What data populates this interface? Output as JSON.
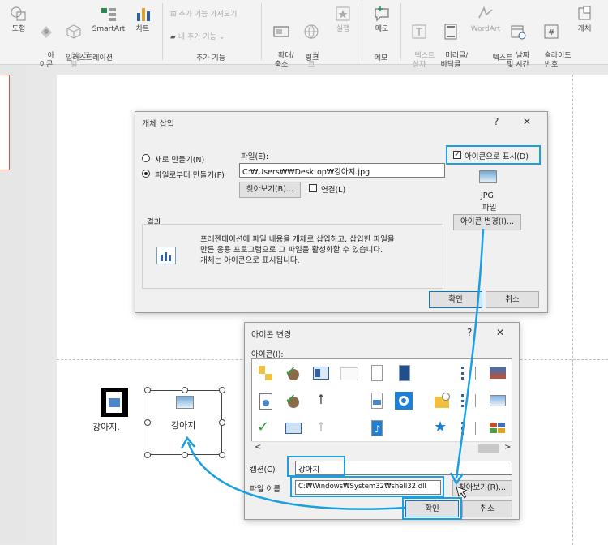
{
  "ribbon": {
    "groups": {
      "illustrations": {
        "label": "일러스트레이션",
        "items": [
          "도형",
          "아\n이콘",
          "3D 모\n델",
          "SmartArt",
          "차트"
        ]
      },
      "addins": {
        "label": "추가 기능",
        "get": "추가 기능 가져오기",
        "mine": "내 추가 기능"
      },
      "links": {
        "label": "링크",
        "items": [
          "확대/\n축소",
          "링\n크",
          "실행"
        ]
      },
      "comments": {
        "label": "메모",
        "items": [
          "메모"
        ]
      },
      "text": {
        "label": "텍스트",
        "items": [
          "텍스트\n상자",
          "머리글/\n바닥글",
          "WordArt",
          "날짜\n및 시간",
          "슬라이드\n번호",
          "개체"
        ]
      }
    }
  },
  "insert_object": {
    "title": "개체 삽입",
    "help": "?",
    "close": "✕",
    "radio_new": "새로 만들기(N)",
    "radio_from_file": "파일로부터 만들기(F)",
    "file_label": "파일(E):",
    "file_path": "C:₩Users₩₩Desktop₩강아지.jpg",
    "browse": "찾아보기(B)...",
    "link": "연결(L)",
    "display_as_icon": "아이콘으로 표시(D)",
    "icon_caption_1": "JPG",
    "icon_caption_2": "파일",
    "change_icon": "아이콘 변경(I)...",
    "result_label": "결과",
    "result_text_1": "프레젠테이션에 파일 내용을 개체로 삽입하고, 삽입한 파일을",
    "result_text_2": "만든 응용 프로그램으로 그 파일을 활성화할 수 있습니다.",
    "result_text_3": "개체는 아이콘으로 표시됩니다.",
    "ok": "확인",
    "cancel": "취소"
  },
  "change_icon": {
    "title": "아이콘 변경",
    "help": "?",
    "close": "✕",
    "icons_label": "아이콘(I):",
    "caption_label": "캡션(C)",
    "caption_value": "강아지",
    "filename_label": "파일 이름",
    "filename_value": "C:₩Windows₩System32₩shell32.dll",
    "browse": "찾아보기(R)...",
    "ok": "확인",
    "cancel": "취소"
  },
  "slide": {
    "icon_label": "강아지.",
    "object_label": "강아지"
  },
  "colors": {
    "highlight": "#1aa0e0",
    "accent_red": "#c65a3b"
  }
}
